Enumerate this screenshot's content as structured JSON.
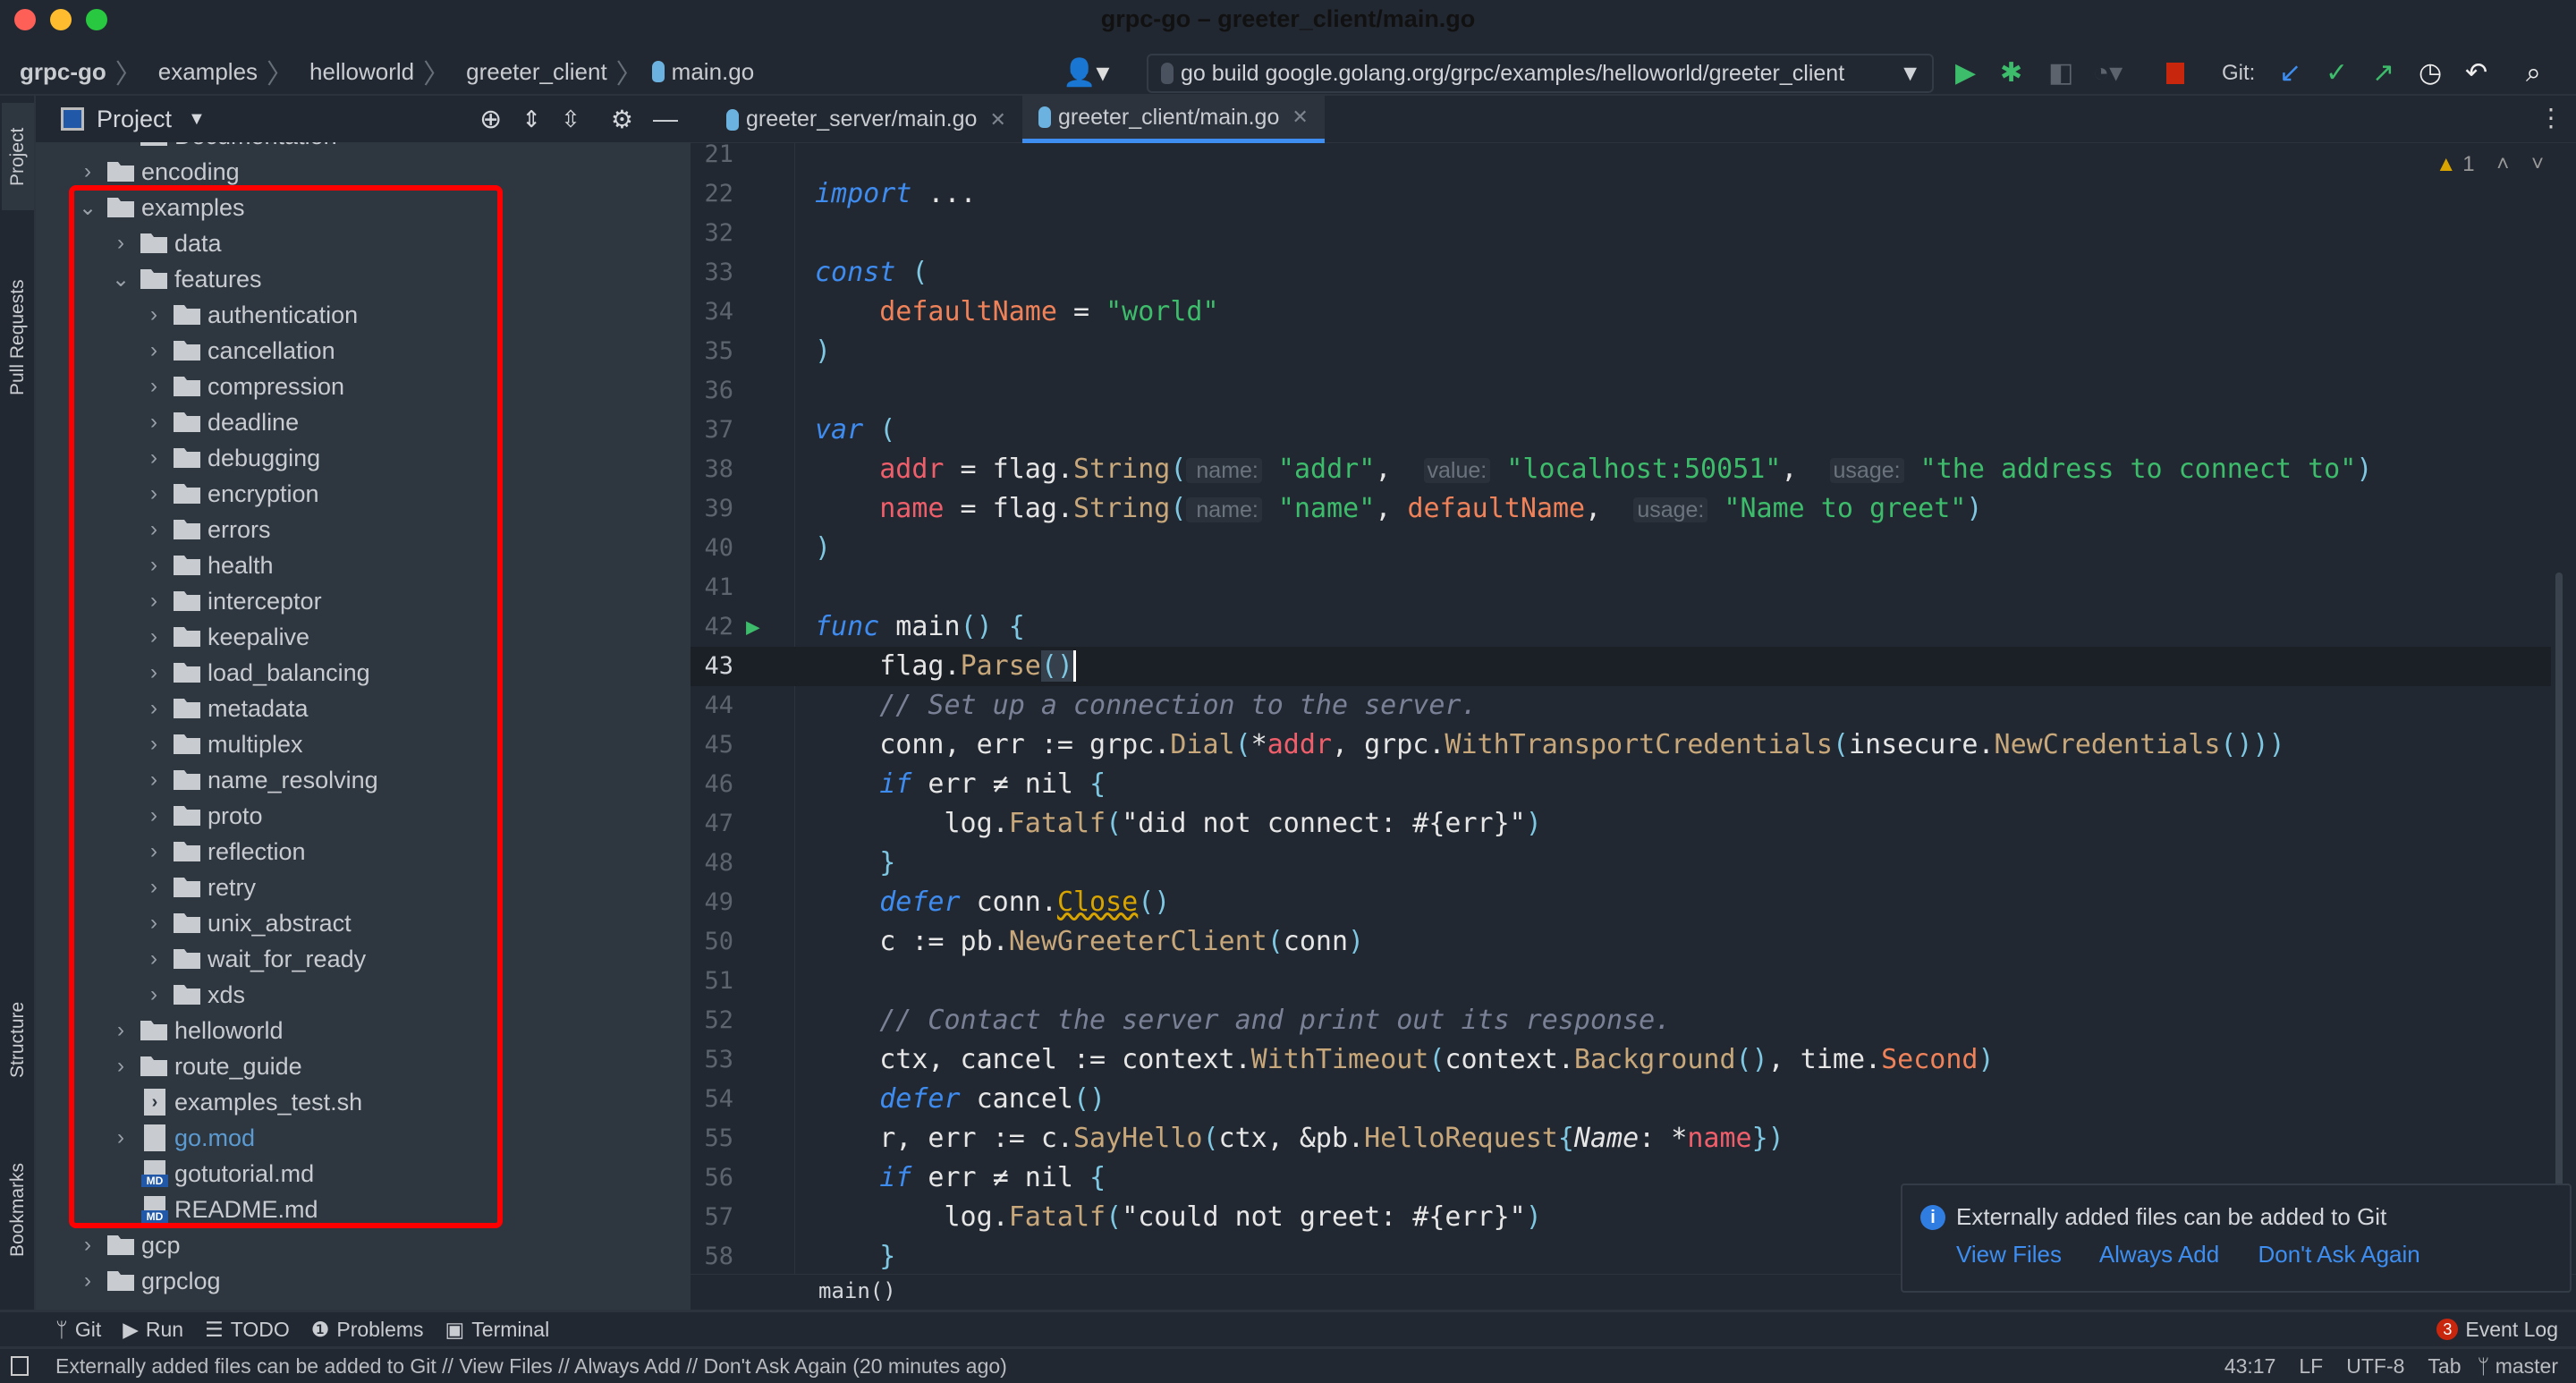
{
  "window": {
    "title": "grpc-go – greeter_client/main.go"
  },
  "breadcrumb": [
    "grpc-go",
    "examples",
    "helloworld",
    "greeter_client",
    "main.go"
  ],
  "run_config": {
    "label": "go build google.golang.org/grpc/examples/helloworld/greeter_client"
  },
  "toolbar": {
    "git_label": "Git:",
    "icons": [
      "run-icon",
      "debug-icon",
      "coverage-icon",
      "profile-icon",
      "stop-icon",
      "update-icon",
      "commit-icon",
      "push-icon",
      "history-icon",
      "rollback-icon",
      "search-icon"
    ]
  },
  "left_strip": [
    "Project",
    "Pull Requests",
    "Structure",
    "Bookmarks"
  ],
  "project": {
    "title": "Project",
    "tree": [
      {
        "label": "Documentation",
        "level": 1,
        "type": "folder",
        "chev": ""
      },
      {
        "label": "encoding",
        "level": 0,
        "type": "folder",
        "chev": "›"
      },
      {
        "label": "examples",
        "level": 0,
        "type": "folder",
        "chev": "⌄"
      },
      {
        "label": "data",
        "level": 1,
        "type": "folder",
        "chev": "›"
      },
      {
        "label": "features",
        "level": 1,
        "type": "folder",
        "chev": "⌄"
      },
      {
        "label": "authentication",
        "level": 2,
        "type": "folder",
        "chev": "›"
      },
      {
        "label": "cancellation",
        "level": 2,
        "type": "folder",
        "chev": "›"
      },
      {
        "label": "compression",
        "level": 2,
        "type": "folder",
        "chev": "›"
      },
      {
        "label": "deadline",
        "level": 2,
        "type": "folder",
        "chev": "›"
      },
      {
        "label": "debugging",
        "level": 2,
        "type": "folder",
        "chev": "›"
      },
      {
        "label": "encryption",
        "level": 2,
        "type": "folder",
        "chev": "›"
      },
      {
        "label": "errors",
        "level": 2,
        "type": "folder",
        "chev": "›"
      },
      {
        "label": "health",
        "level": 2,
        "type": "folder",
        "chev": "›"
      },
      {
        "label": "interceptor",
        "level": 2,
        "type": "folder",
        "chev": "›"
      },
      {
        "label": "keepalive",
        "level": 2,
        "type": "folder",
        "chev": "›"
      },
      {
        "label": "load_balancing",
        "level": 2,
        "type": "folder",
        "chev": "›"
      },
      {
        "label": "metadata",
        "level": 2,
        "type": "folder",
        "chev": "›"
      },
      {
        "label": "multiplex",
        "level": 2,
        "type": "folder",
        "chev": "›"
      },
      {
        "label": "name_resolving",
        "level": 2,
        "type": "folder",
        "chev": "›"
      },
      {
        "label": "proto",
        "level": 2,
        "type": "folder",
        "chev": "›"
      },
      {
        "label": "reflection",
        "level": 2,
        "type": "folder",
        "chev": "›"
      },
      {
        "label": "retry",
        "level": 2,
        "type": "folder",
        "chev": "›"
      },
      {
        "label": "unix_abstract",
        "level": 2,
        "type": "folder",
        "chev": "›"
      },
      {
        "label": "wait_for_ready",
        "level": 2,
        "type": "folder",
        "chev": "›"
      },
      {
        "label": "xds",
        "level": 2,
        "type": "folder",
        "chev": "›"
      },
      {
        "label": "helloworld",
        "level": 1,
        "type": "folder",
        "chev": "›"
      },
      {
        "label": "route_guide",
        "level": 1,
        "type": "folder",
        "chev": "›"
      },
      {
        "label": "examples_test.sh",
        "level": 1,
        "type": "sh",
        "chev": ""
      },
      {
        "label": "go.mod",
        "level": 1,
        "type": "mod",
        "chev": "›",
        "color": "#5b9bd1"
      },
      {
        "label": "gotutorial.md",
        "level": 1,
        "type": "md",
        "chev": ""
      },
      {
        "label": "README.md",
        "level": 1,
        "type": "md",
        "chev": ""
      },
      {
        "label": "gcp",
        "level": 0,
        "type": "folder",
        "chev": "›"
      },
      {
        "label": "grpclog",
        "level": 0,
        "type": "folder",
        "chev": "›"
      }
    ]
  },
  "tabs": [
    {
      "label": "greeter_server/main.go",
      "active": false
    },
    {
      "label": "greeter_client/main.go",
      "active": true
    }
  ],
  "inspections": {
    "warnings": "1"
  },
  "editor": {
    "current_line": 43,
    "lines": [
      {
        "n": 21,
        "t": []
      },
      {
        "n": 22,
        "t": [
          [
            "import",
            "kw"
          ],
          [
            " ...",
            "pl"
          ]
        ]
      },
      {
        "n": 32,
        "t": []
      },
      {
        "n": 33,
        "t": [
          [
            "const",
            "kw"
          ],
          [
            " (",
            "par"
          ]
        ]
      },
      {
        "n": 34,
        "t": [
          [
            "    defaultName",
            "cst"
          ],
          [
            " = ",
            "pl"
          ],
          [
            "\"world\"",
            "str"
          ]
        ]
      },
      {
        "n": 35,
        "t": [
          [
            ")",
            "par"
          ]
        ]
      },
      {
        "n": 36,
        "t": []
      },
      {
        "n": 37,
        "t": [
          [
            "var",
            "kw"
          ],
          [
            " (",
            "par"
          ]
        ]
      },
      {
        "n": 38,
        "t": [
          [
            "    addr",
            "var"
          ],
          [
            " = flag.",
            "pl"
          ],
          [
            "String",
            "fn"
          ],
          [
            "(",
            "par"
          ],
          [
            " name:",
            "hint"
          ],
          [
            " \"addr\"",
            "str"
          ],
          [
            ",  ",
            "pl"
          ],
          [
            "value:",
            "hint"
          ],
          [
            " \"localhost:50051\"",
            "str"
          ],
          [
            ",  ",
            "pl"
          ],
          [
            "usage:",
            "hint"
          ],
          [
            " \"the address to connect to\"",
            "str"
          ],
          [
            ")",
            "par"
          ]
        ]
      },
      {
        "n": 39,
        "t": [
          [
            "    name",
            "var"
          ],
          [
            " = flag.",
            "pl"
          ],
          [
            "String",
            "fn"
          ],
          [
            "(",
            "par"
          ],
          [
            " name:",
            "hint"
          ],
          [
            " \"name\"",
            "str"
          ],
          [
            ", ",
            "pl"
          ],
          [
            "defaultName",
            "cst"
          ],
          [
            ",  ",
            "pl"
          ],
          [
            "usage:",
            "hint"
          ],
          [
            " \"Name to greet\"",
            "str"
          ],
          [
            ")",
            "par"
          ]
        ]
      },
      {
        "n": 40,
        "t": [
          [
            ")",
            "par"
          ]
        ]
      },
      {
        "n": 41,
        "t": []
      },
      {
        "n": 42,
        "t": [
          [
            "func",
            "kw"
          ],
          [
            " main",
            "pl"
          ],
          [
            "()",
            "par"
          ],
          [
            " {",
            "par"
          ]
        ]
      },
      {
        "n": 43,
        "t": [
          [
            "    flag.",
            "pl"
          ],
          [
            "Parse",
            "fn"
          ],
          [
            "()",
            "br"
          ]
        ]
      },
      {
        "n": 44,
        "t": [
          [
            "    // Set up a connection to the server.",
            "cm"
          ]
        ]
      },
      {
        "n": 45,
        "t": [
          [
            "    conn, err := grpc.",
            "pl"
          ],
          [
            "Dial",
            "fn"
          ],
          [
            "(",
            "par"
          ],
          [
            "*",
            "pl"
          ],
          [
            "addr",
            "var"
          ],
          [
            ", grpc.",
            "pl"
          ],
          [
            "WithTransportCredentials",
            "fn"
          ],
          [
            "(",
            "par"
          ],
          [
            "insecure.",
            "pl"
          ],
          [
            "NewCredentials",
            "fn"
          ],
          [
            "()))",
            "par"
          ]
        ]
      },
      {
        "n": 46,
        "t": [
          [
            "    if",
            "kw"
          ],
          [
            " err ≠ nil ",
            "pl"
          ],
          [
            "{",
            "par"
          ]
        ]
      },
      {
        "n": 47,
        "t": [
          [
            "        log.",
            "pl"
          ],
          [
            "Fatalf",
            "fn"
          ],
          [
            "(",
            "par"
          ],
          [
            "\"did not connect: #{err}\"",
            "pl"
          ],
          [
            ")",
            "par"
          ]
        ]
      },
      {
        "n": 48,
        "t": [
          [
            "    }",
            "par"
          ]
        ]
      },
      {
        "n": 49,
        "t": [
          [
            "    defer",
            "kw"
          ],
          [
            " conn.",
            "pl"
          ],
          [
            "Close",
            "wfn"
          ],
          [
            "()",
            "par"
          ]
        ]
      },
      {
        "n": 50,
        "t": [
          [
            "    c := pb.",
            "pl"
          ],
          [
            "NewGreeterClient",
            "fn"
          ],
          [
            "(",
            "par"
          ],
          [
            "conn",
            "pl"
          ],
          [
            ")",
            "par"
          ]
        ]
      },
      {
        "n": 51,
        "t": []
      },
      {
        "n": 52,
        "t": [
          [
            "    // Contact the server and print out its response.",
            "cm"
          ]
        ]
      },
      {
        "n": 53,
        "t": [
          [
            "    ctx, cancel := context.",
            "pl"
          ],
          [
            "WithTimeout",
            "fn"
          ],
          [
            "(",
            "par"
          ],
          [
            "context.",
            "pl"
          ],
          [
            "Background",
            "fn"
          ],
          [
            "()",
            "par"
          ],
          [
            ", time.",
            "pl"
          ],
          [
            "Second",
            "cst"
          ],
          [
            ")",
            "par"
          ]
        ]
      },
      {
        "n": 54,
        "t": [
          [
            "    defer",
            "kw"
          ],
          [
            " cancel",
            "pl"
          ],
          [
            "()",
            "par"
          ]
        ]
      },
      {
        "n": 55,
        "t": [
          [
            "    r, err := c.",
            "pl"
          ],
          [
            "SayHello",
            "fn"
          ],
          [
            "(",
            "par"
          ],
          [
            "ctx, &pb.",
            "pl"
          ],
          [
            "HelloRequest",
            "fn"
          ],
          [
            "{",
            "par"
          ],
          [
            "Name",
            "it"
          ],
          [
            ": *",
            "pl"
          ],
          [
            "name",
            "var"
          ],
          [
            "})",
            "par"
          ]
        ]
      },
      {
        "n": 56,
        "t": [
          [
            "    if",
            "kw"
          ],
          [
            " err ≠ nil ",
            "pl"
          ],
          [
            "{",
            "par"
          ]
        ]
      },
      {
        "n": 57,
        "t": [
          [
            "        log.",
            "pl"
          ],
          [
            "Fatalf",
            "fn"
          ],
          [
            "(",
            "par"
          ],
          [
            "\"could not greet: #{err}\"",
            "pl"
          ],
          [
            ")",
            "par"
          ]
        ]
      },
      {
        "n": 58,
        "t": [
          [
            "    }",
            "par"
          ]
        ]
      }
    ]
  },
  "code_breadcrumb": "main()",
  "notification": {
    "message": "Externally added files can be added to Git",
    "actions": [
      "View Files",
      "Always Add",
      "Don't Ask Again"
    ]
  },
  "tool_windows": [
    "Git",
    "Run",
    "TODO",
    "Problems",
    "Terminal"
  ],
  "event_log": {
    "label": "Event Log",
    "count": "3"
  },
  "status": {
    "message": "Externally added files can be added to Git // View Files // Always Add // Don't Ask Again (20 minutes ago)",
    "position": "43:17",
    "line_sep": "LF",
    "encoding": "UTF-8",
    "indent": "Tab",
    "branch": "master"
  },
  "colors": {
    "accent": "#3d8ef0",
    "highlight_box": "#ff0000",
    "editor_bg": "#222831",
    "sidebar_bg": "#2e3640"
  }
}
